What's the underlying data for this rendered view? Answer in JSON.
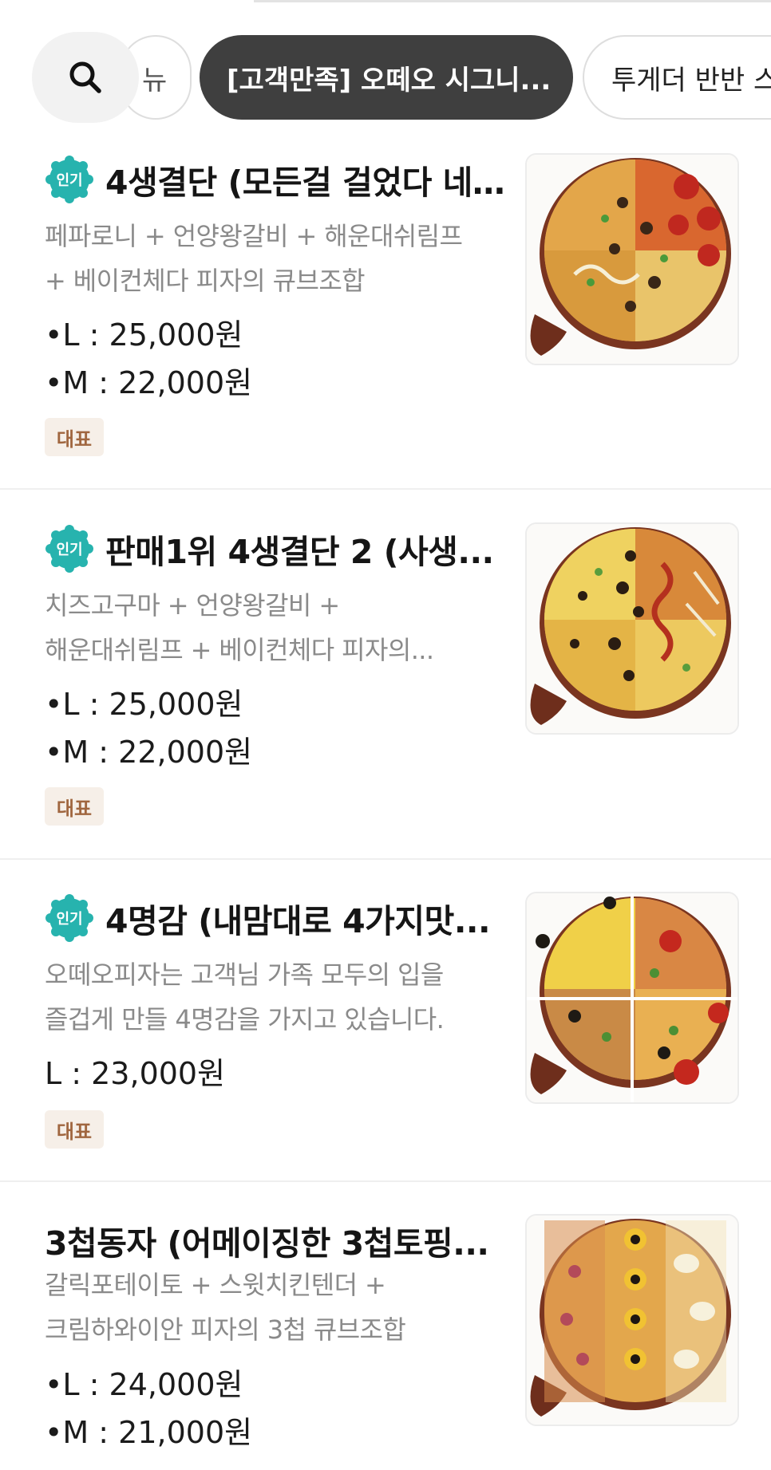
{
  "filters": {
    "search_icon": "search-icon",
    "chips": [
      {
        "label": "뉴",
        "active": false
      },
      {
        "label": "[고객만족] 오떼오 시그니...",
        "active": true
      },
      {
        "label": "투게더 반반 스",
        "active": false
      }
    ]
  },
  "colors": {
    "active_chip_bg": "#3f3f3f",
    "badge_teal": "#27b3ae",
    "tag_bg": "#f6efe8",
    "tag_text": "#a0663f",
    "desc_gray": "#8a8a8a"
  },
  "menu_items": [
    {
      "badge": "인기",
      "title": "4생결단 (모든걸 걸었다 네...",
      "desc_lines": [
        "페파로니 + 언양왕갈비 + 해운대쉬림프",
        "+ 베이컨체다 피자의 큐브조합"
      ],
      "prices": [
        "•L : 25,000원",
        "•M : 22,000원"
      ],
      "tag": "대표",
      "image_icon": "pizza-quad-image"
    },
    {
      "badge": "인기",
      "title": "판매1위  4생결단 2 (사생...",
      "desc_lines": [
        "치즈고구마 + 언양왕갈비 +",
        "해운대쉬림프 + 베이컨체다 피자의..."
      ],
      "prices": [
        "•L : 25,000원",
        "•M : 22,000원"
      ],
      "tag": "대표",
      "image_icon": "pizza-quad-image"
    },
    {
      "badge": "인기",
      "title": "4명감 (내맘대로 4가지맛...",
      "desc_lines": [
        "오떼오피자는 고객님 가족 모두의 입을",
        "즐겁게 만들 4명감을 가지고 있습니다."
      ],
      "prices": [
        "L : 23,000원"
      ],
      "tag": "대표",
      "image_icon": "pizza-grid-image"
    },
    {
      "badge": "",
      "title": "3첩동자 (어메이징한 3첩토핑...",
      "desc_lines": [
        "갈릭포테이토 + 스윗치킨텐더 +",
        "크림하와이안 피자의 3첩 큐브조합"
      ],
      "prices": [
        "•L : 24,000원",
        "•M : 21,000원"
      ],
      "tag": "",
      "image_icon": "pizza-triple-image"
    }
  ]
}
